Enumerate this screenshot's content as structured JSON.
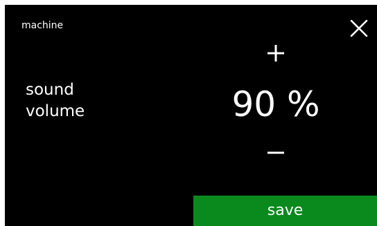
{
  "header": {
    "title": "machine"
  },
  "setting": {
    "label": "sound\nvolume",
    "value": 90,
    "unit": "%",
    "display": "90 %"
  },
  "icons": {
    "close": "close-icon",
    "increase": "plus-icon",
    "decrease": "minus-icon"
  },
  "actions": {
    "save_label": "save"
  },
  "colors": {
    "background": "#000000",
    "text": "#ffffff",
    "save_button": "#0a8a1d"
  }
}
